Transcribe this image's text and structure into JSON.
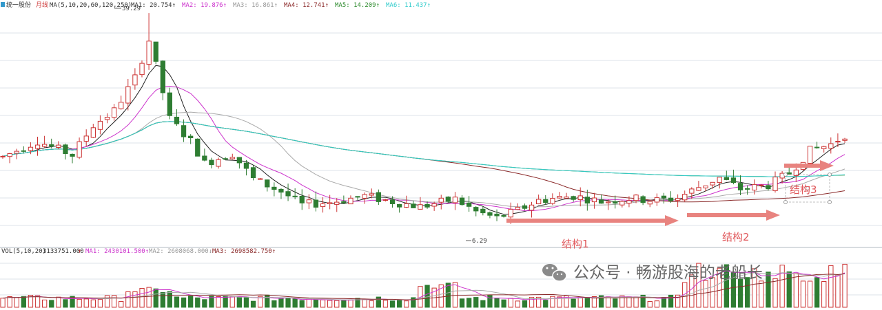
{
  "header": {
    "stock": "统一股份",
    "period": "月线",
    "ma_params": "MA(5,10,20,60,120,250)",
    "items": [
      {
        "label": "MA1:",
        "value": "20.754",
        "arrow": "↑",
        "color": "#333333"
      },
      {
        "label": "MA2:",
        "value": "19.876",
        "arrow": "↑",
        "color": "#cc33cc"
      },
      {
        "label": "MA3:",
        "value": "16.861",
        "arrow": "↑",
        "color": "#999999"
      },
      {
        "label": "MA4:",
        "value": "12.741",
        "arrow": "↑",
        "color": "#8b2a2a"
      },
      {
        "label": "MA5:",
        "value": "14.209",
        "arrow": "↑",
        "color": "#2e8b2e"
      },
      {
        "label": "MA6:",
        "value": "11.437",
        "arrow": "↑",
        "color": "#33cccc"
      }
    ]
  },
  "volume_header": {
    "params": "VOL(5,10,20)",
    "value": "3133751.000",
    "value_arrow": "↑",
    "items": [
      {
        "label": "MA1:",
        "value": "2430101.500",
        "arrow": "↑",
        "color": "#cc33cc"
      },
      {
        "label": "MA2:",
        "value": "2608068.000",
        "arrow": "↓",
        "color": "#999999"
      },
      {
        "label": "MA3:",
        "value": "2698582.750",
        "arrow": "↑",
        "color": "#8b2a2a"
      }
    ]
  },
  "annotations": {
    "high_label": "39.29",
    "low_label": "6.29",
    "structure1": "结构1",
    "structure2": "结构2",
    "structure3": "结构3"
  },
  "watermark": {
    "text": "公众号 · 畅游股海的老船长",
    "icon": "wechat-icon"
  },
  "colors": {
    "up": "#cc3333",
    "down": "#2e7d32",
    "grid": "#dde3ea",
    "annotation": "#e0575a"
  },
  "chart_data": {
    "type": "candlestick",
    "title": "统一股份 月线",
    "series_count": 122,
    "price_range": [
      6.29,
      39.29
    ],
    "price_labels": [
      39.29,
      6.29
    ],
    "seed": 7,
    "ma_latest": {
      "MA1": 20.754,
      "MA2": 19.876,
      "MA3": 16.861,
      "MA4": 12.741,
      "MA5": 14.209,
      "MA6": 11.437
    },
    "volume_latest": 3133751.0,
    "volume_ma_latest": {
      "MA1": 2430101.5,
      "MA2": 2608068.0,
      "MA3": 2698582.75
    }
  }
}
